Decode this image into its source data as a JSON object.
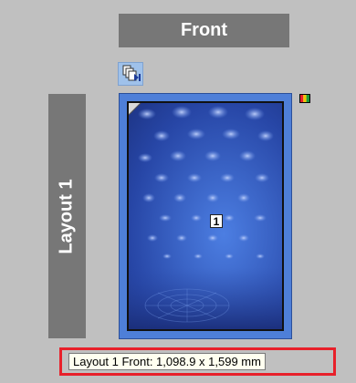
{
  "header": {
    "side_label": "Front"
  },
  "layout": {
    "label": "Layout 1"
  },
  "page": {
    "number": "1"
  },
  "icons": {
    "pages": "page-stack-icon",
    "color": "color-swatch-icon",
    "corner": "page-corner-icon"
  },
  "colors": {
    "frame": "#4e7fd8",
    "artwork": "#2f55b8",
    "highlight": "#e8202a",
    "label_bg": "#777777"
  },
  "status": {
    "text": "Layout 1 Front: 1,098.9 x 1,599 mm"
  }
}
